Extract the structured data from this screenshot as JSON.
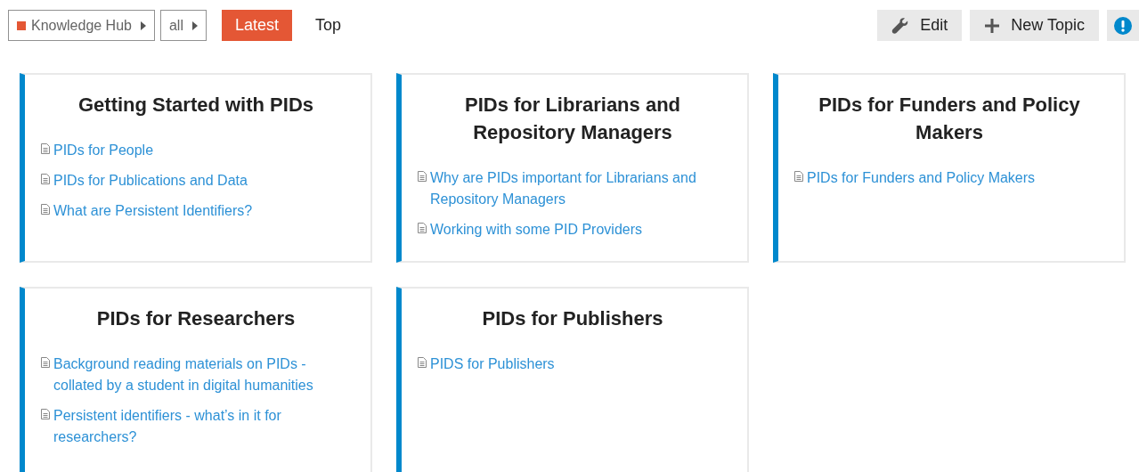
{
  "breadcrumbs": [
    {
      "label": "Knowledge Hub",
      "kind": "category"
    },
    {
      "label": "all",
      "kind": "plain"
    }
  ],
  "nav_tabs": [
    {
      "label": "Latest",
      "selected": true
    },
    {
      "label": "Top",
      "selected": false
    }
  ],
  "actions": [
    {
      "label": "Edit",
      "kind": "edit"
    },
    {
      "label": "New Topic",
      "kind": "new"
    },
    {
      "kind": "info"
    }
  ],
  "categories": [
    {
      "title": "Getting Started with PIDs",
      "topics": [
        "PIDs for People",
        "PIDs for Publications and Data",
        "What are Persistent Identifiers?"
      ]
    },
    {
      "title": "PIDs for Librarians and Repository Managers",
      "topics": [
        "Why are PIDs important for Librarians and Repository Managers",
        "Working with some PID Providers"
      ]
    },
    {
      "title": "PIDs for Funders and Policy Makers",
      "topics": [
        "PIDs for Funders and Policy Makers"
      ]
    },
    {
      "title": "PIDs for Researchers",
      "topics": [
        "Background reading materials on PIDs - collated by a student in digital humanities",
        "Persistent identifiers - what’s in it for researchers?"
      ]
    },
    {
      "title": "PIDs for Publishers",
      "topics": [
        "PIDS for Publishers"
      ]
    }
  ]
}
